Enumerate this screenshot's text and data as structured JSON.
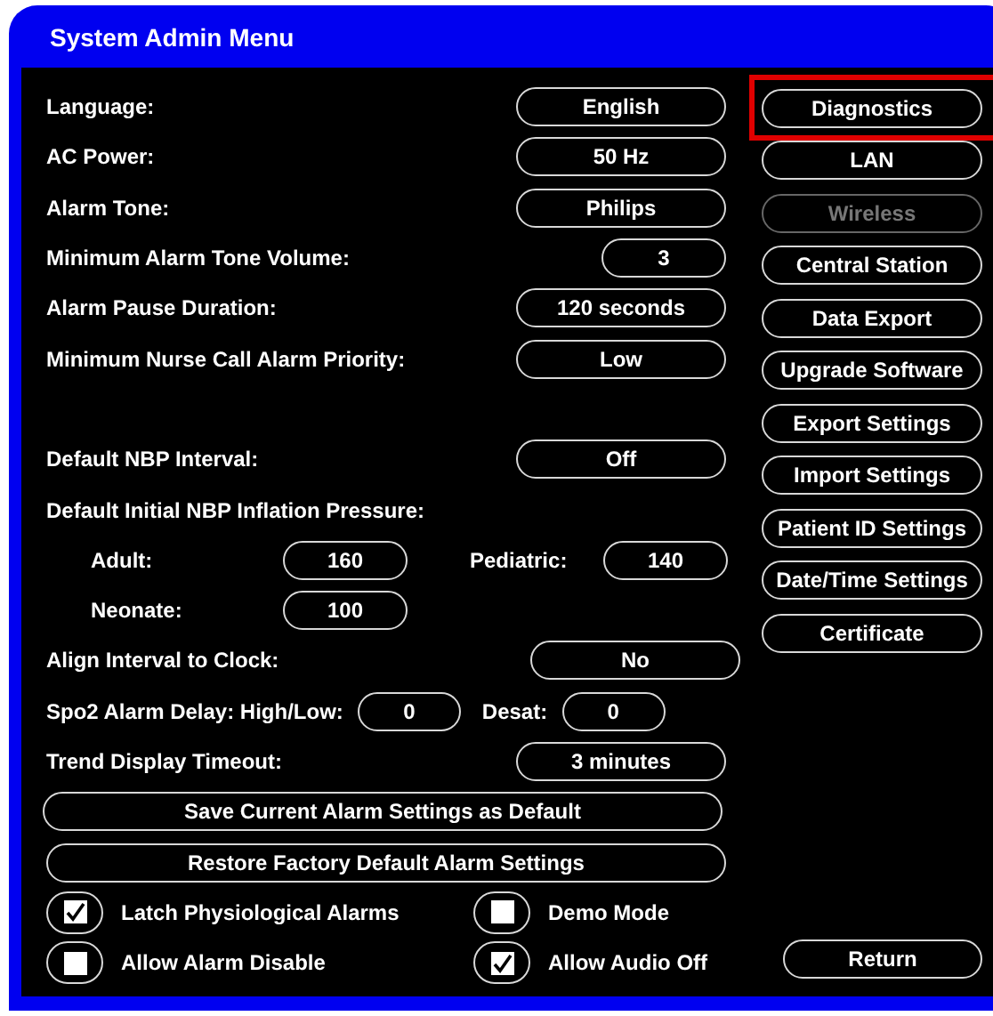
{
  "window": {
    "title": "System Admin Menu"
  },
  "settings": [
    {
      "kind": "select",
      "label": "Language:",
      "value": "English"
    },
    {
      "kind": "select",
      "label": "AC Power:",
      "value": "50 Hz"
    },
    {
      "kind": "select",
      "label": "Alarm Tone:",
      "value": "Philips"
    },
    {
      "kind": "narrow",
      "label": "Minimum Alarm Tone Volume:",
      "value": "3"
    },
    {
      "kind": "select",
      "label": "Alarm Pause Duration:",
      "value": "120 seconds"
    },
    {
      "kind": "select",
      "label": "Minimum Nurse Call Alarm Priority:",
      "value": "Low"
    },
    {
      "kind": "gap"
    },
    {
      "kind": "select",
      "label": "Default NBP Interval:",
      "value": "Off"
    },
    {
      "kind": "heading",
      "label": "Default Initial NBP Inflation Pressure:"
    },
    {
      "kind": "sub-pair",
      "items": [
        {
          "label": "Adult:",
          "value": "160"
        },
        {
          "label": "Pediatric:",
          "value": "140"
        }
      ]
    },
    {
      "kind": "sub-pair",
      "items": [
        {
          "label": "Neonate:",
          "value": "100"
        }
      ]
    },
    {
      "kind": "offset",
      "label": "Align Interval to Clock:",
      "value": "No"
    },
    {
      "kind": "pair",
      "items": [
        {
          "label": "Spo2 Alarm Delay: High/Low:",
          "value": "0"
        },
        {
          "label": "Desat:",
          "value": "0"
        }
      ]
    },
    {
      "kind": "select",
      "label": "Trend Display Timeout:",
      "value": "3 minutes"
    }
  ],
  "actions": [
    "Save Current Alarm Settings as Default",
    "Restore Factory Default Alarm Settings"
  ],
  "checkboxes": [
    {
      "label": "Latch Physiological Alarms",
      "checked": true
    },
    {
      "label": "Demo Mode",
      "checked": false
    },
    {
      "label": "Allow Alarm Disable",
      "checked": false
    },
    {
      "label": "Allow Audio Off",
      "checked": true
    }
  ],
  "menu_buttons": [
    {
      "label": "Diagnostics",
      "disabled": false,
      "highlighted": true
    },
    {
      "label": "LAN",
      "disabled": false,
      "highlighted": false
    },
    {
      "label": "Wireless",
      "disabled": true,
      "highlighted": false
    },
    {
      "label": "Central Station",
      "disabled": false,
      "highlighted": false
    },
    {
      "label": "Data Export",
      "disabled": false,
      "highlighted": false
    },
    {
      "label": "Upgrade Software",
      "disabled": false,
      "highlighted": false
    },
    {
      "label": "Export Settings",
      "disabled": false,
      "highlighted": false
    },
    {
      "label": "Import Settings",
      "disabled": false,
      "highlighted": false
    },
    {
      "label": "Patient ID Settings",
      "disabled": false,
      "highlighted": false
    },
    {
      "label": "Date/Time Settings",
      "disabled": false,
      "highlighted": false
    },
    {
      "label": "Certificate",
      "disabled": false,
      "highlighted": false
    }
  ],
  "return_button": "Return"
}
